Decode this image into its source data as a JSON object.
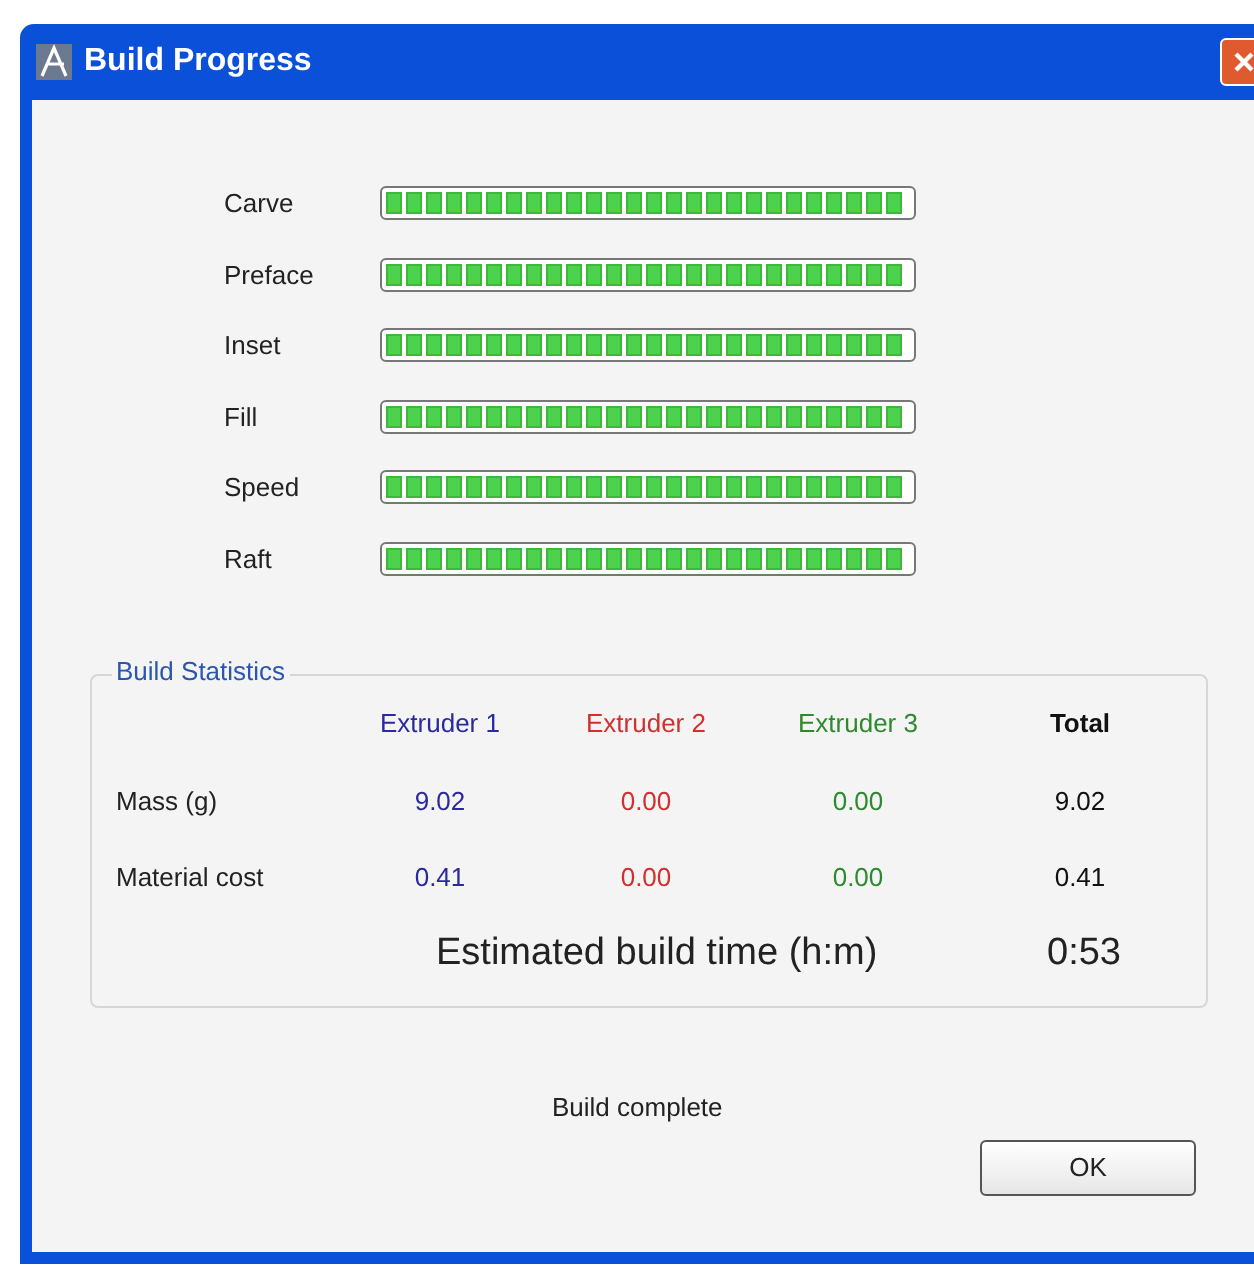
{
  "window": {
    "title": "Build Progress"
  },
  "progress": [
    {
      "label": "Carve",
      "level": 1
    },
    {
      "label": "Preface",
      "level": 1
    },
    {
      "label": "Inset",
      "level": 1
    },
    {
      "label": "Fill",
      "level": 1
    },
    {
      "label": "Speed",
      "level": 1
    },
    {
      "label": "Raft",
      "level": 1
    }
  ],
  "statistics": {
    "title": "Build Statistics",
    "columns": [
      {
        "label": "Extruder 1",
        "color": "#2a2aa0"
      },
      {
        "label": "Extruder 2",
        "color": "#d03030"
      },
      {
        "label": "Extruder 3",
        "color": "#2e8a2e"
      },
      {
        "label": "Total",
        "color": "#111111"
      }
    ],
    "rows": [
      {
        "label": "Mass (g)",
        "values": [
          "9.02",
          "0.00",
          "0.00",
          "9.02"
        ]
      },
      {
        "label": "Material cost",
        "values": [
          "0.41",
          "0.00",
          "0.00",
          "0.41"
        ]
      }
    ],
    "estimate": {
      "label": "Estimated build time (h:m)",
      "value": "0:53"
    }
  },
  "status": "Build complete",
  "buttons": [
    "OK"
  ]
}
